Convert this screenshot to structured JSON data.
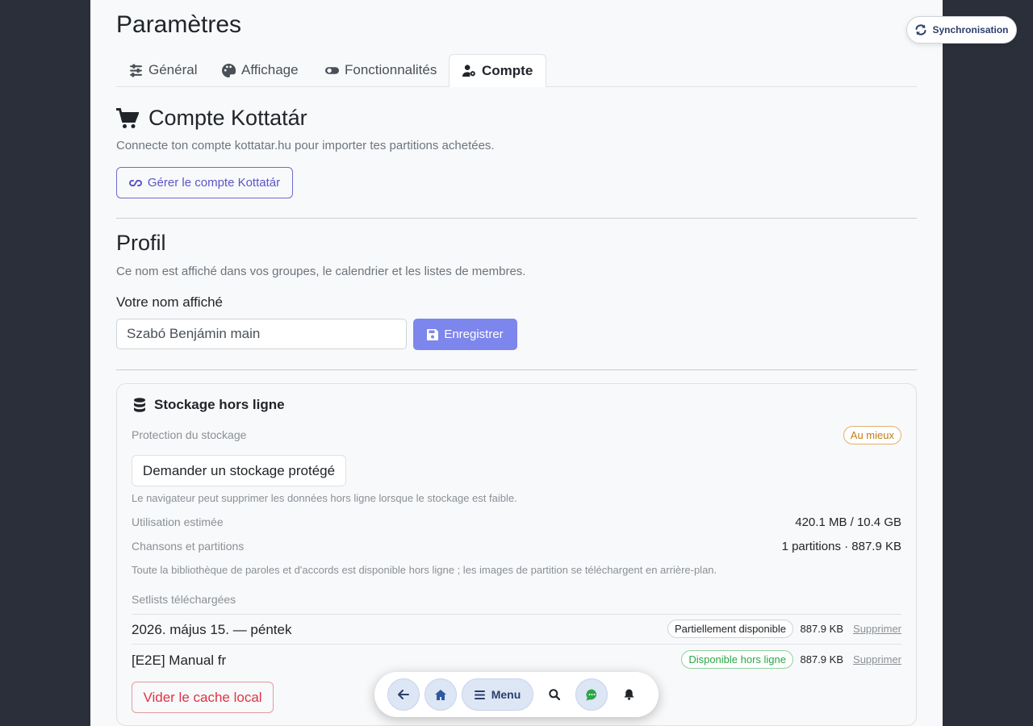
{
  "page_title": "Paramètres",
  "tabs": [
    {
      "label": "Général",
      "icon": "sliders-icon"
    },
    {
      "label": "Affichage",
      "icon": "palette-icon"
    },
    {
      "label": "Fonctionnalités",
      "icon": "toggle-icon"
    },
    {
      "label": "Compte",
      "icon": "user-gear-icon",
      "active": true
    }
  ],
  "kottatar": {
    "title": "Compte Kottatár",
    "description": "Connecte ton compte kottatar.hu pour importer tes partitions achetées.",
    "manage_button": "Gérer le compte Kottatár"
  },
  "profile": {
    "title": "Profil",
    "description": "Ce nom est affiché dans vos groupes, le calendrier et les listes de membres.",
    "name_label": "Votre nom affiché",
    "name_value": "Szabó Benjámin main",
    "save_button": "Enregistrer"
  },
  "storage": {
    "title": "Stockage hors ligne",
    "protection_label": "Protection du stockage",
    "protection_badge": "Au mieux",
    "request_button": "Demander un stockage protégé",
    "browser_note": "Le navigateur peut supprimer les données hors ligne lorsque le stockage est faible.",
    "usage_label": "Utilisation estimée",
    "usage_value": "420.1 MB / 10.4 GB",
    "songs_label": "Chansons et partitions",
    "songs_value": "1 partitions · 887.9 KB",
    "library_note": "Toute la bibliothèque de paroles et d'accords est disponible hors ligne ; les images de partition se téléchargent en arrière-plan.",
    "setlists_label": "Setlists téléchargées",
    "setlists": [
      {
        "name": "2026. május 15. — péntek",
        "status": "Partiellement disponible",
        "size": "887.9 KB",
        "delete": "Supprimer"
      },
      {
        "name": "[E2E] Manual fr",
        "status": "Disponible hors ligne",
        "size": "887.9 KB",
        "delete": "Supprimer"
      }
    ],
    "clear_button": "Vider le cache local"
  },
  "sync_button": "Synchronisation",
  "dock": {
    "menu_label": "Menu"
  },
  "colors": {
    "accent": "#7d86ec",
    "danger": "#dc3545",
    "success": "#28a745",
    "warning": "#d08a2a"
  }
}
